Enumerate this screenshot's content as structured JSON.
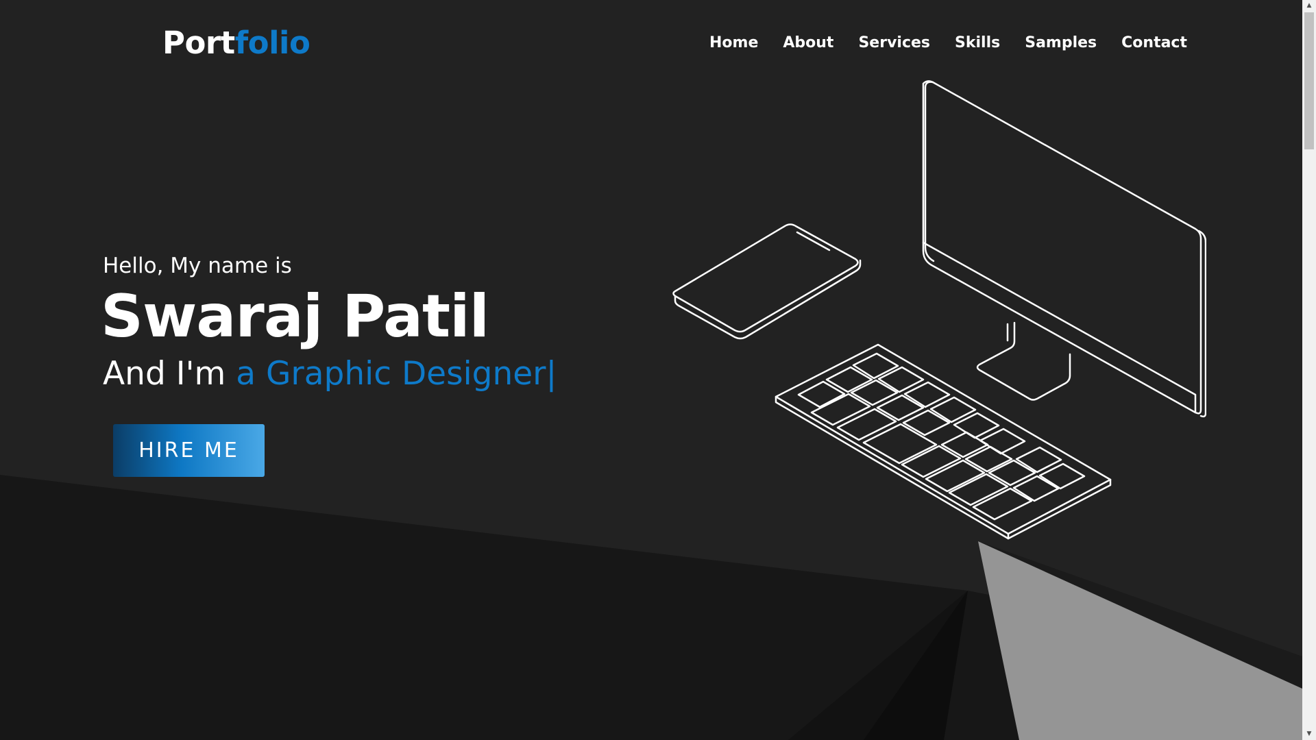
{
  "brand": {
    "part1": "Port",
    "part2": "folio",
    "accent_color": "#0e7ac9"
  },
  "nav": {
    "items": [
      {
        "label": "Home"
      },
      {
        "label": "About"
      },
      {
        "label": "Services"
      },
      {
        "label": "Skills"
      },
      {
        "label": "Samples"
      },
      {
        "label": "Contact"
      }
    ]
  },
  "hero": {
    "greeting": "Hello, My name is",
    "name": "Swaraj Patil",
    "role_prefix": "And I'm ",
    "role_typed": "a Graphic Designer",
    "cursor": "|",
    "cta_label": "HIRE ME"
  },
  "illustration": {
    "icons": [
      "phone-icon",
      "monitor-icon",
      "keyboard-icon"
    ],
    "stroke_color": "#ffffff"
  },
  "scrollbar": {
    "up_icon": "▲",
    "down_icon": "▼"
  },
  "colors": {
    "background": "#222222",
    "dark_shape": "#161616",
    "light_shape": "#959595",
    "button_gradient": [
      "#0b3d66",
      "#0e78c4",
      "#4aa8e6"
    ]
  }
}
